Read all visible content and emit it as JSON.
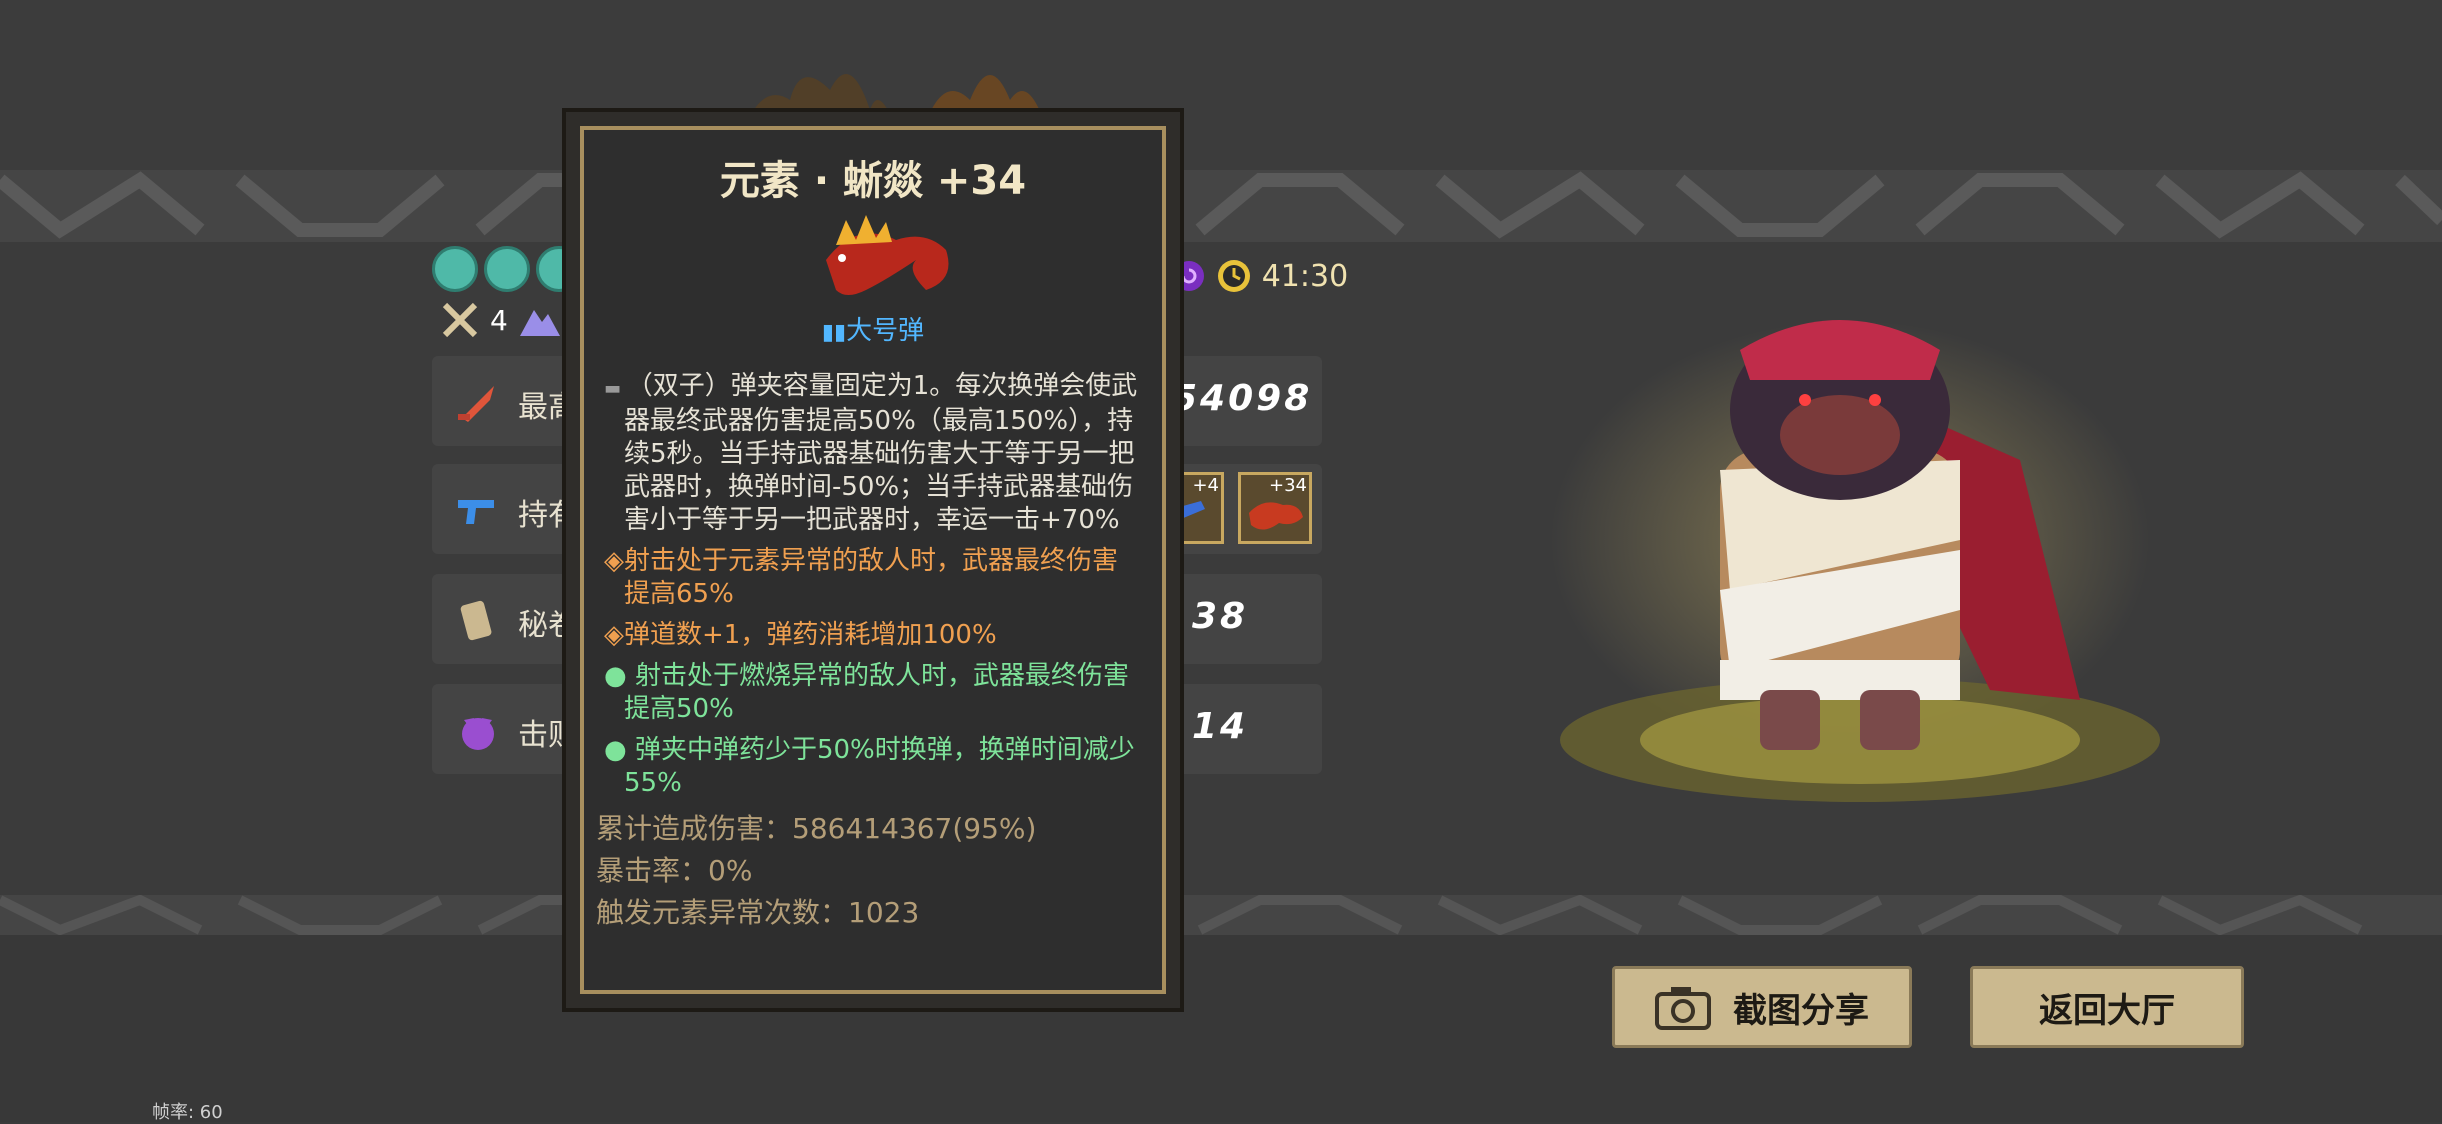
{
  "hud": {
    "weapon_count": "4",
    "time": "41:30",
    "bracket": "]"
  },
  "stats": [
    {
      "label": "最高",
      "value": "54098",
      "icon": "sword-icon"
    },
    {
      "label": "持有",
      "value": "",
      "icon": "gun-icon"
    },
    {
      "label": "秘卷",
      "value": "38",
      "icon": "scroll-icon"
    },
    {
      "label": "击败",
      "value": "14",
      "icon": "demon-icon"
    }
  ],
  "inventory": {
    "slot1_level": "+4",
    "slot2_level": "+34"
  },
  "tooltip": {
    "title": "元素 · 蜥燚 +34",
    "ammo_type": "大号弹",
    "base_effect": "（双子）弹夹容量固定为1。每次换弹会使武器最终武器伤害提高50%（最高150%），持续5秒。当手持武器基础伤害大于等于另一把武器时，换弹时间-50%；当手持武器基础伤害小于等于另一把武器时，幸运一击+70%",
    "orange_effects": [
      "射击处于元素异常的敌人时，武器最终伤害提高65%",
      "弹道数+1，弹药消耗增加100%"
    ],
    "green_effects": [
      "射击处于燃烧异常的敌人时，武器最终伤害提高50%",
      "弹夹中弹药少于50%时换弹，换弹时间减少55%"
    ],
    "damage_total": "累计造成伤害：586414367(95%)",
    "crit_rate": "暴击率：0%",
    "elemental_triggers": "触发元素异常次数：1023"
  },
  "buttons": {
    "share": "截图分享",
    "back": "返回大厅"
  },
  "fps": "帧率: 60",
  "colors": {
    "orange": "#f0a050",
    "green": "#7ee39a",
    "blue": "#52b7ff",
    "gold": "#a88f5e"
  }
}
